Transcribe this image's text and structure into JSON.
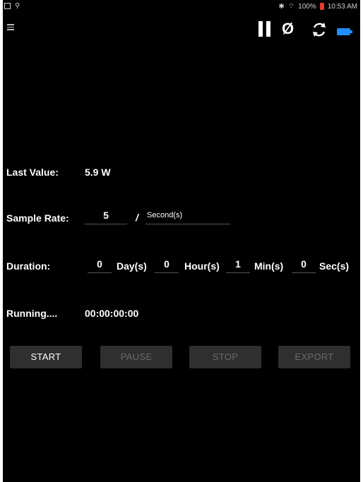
{
  "status_bar": {
    "battery_percent": "100%",
    "time": "10:53 AM",
    "icons": [
      "notification-icon",
      "usb-icon",
      "bluetooth-icon",
      "wifi-icon",
      "battery-low-icon"
    ]
  },
  "toolbar": {
    "icons": [
      "menu-icon",
      "pause-icon",
      "null-icon",
      "refresh-icon",
      "battery-icon"
    ],
    "null_symbol": "Ø",
    "battery_color": "#1e90ff"
  },
  "last_value": {
    "label": "Last Value:",
    "value": "5.9 W"
  },
  "sample_rate": {
    "label": "Sample Rate:",
    "value": "5",
    "separator": "/",
    "unit": "Second(s)"
  },
  "duration": {
    "label": "Duration:",
    "days": {
      "value": "0",
      "unit": "Day(s)"
    },
    "hours": {
      "value": "0",
      "unit": "Hour(s)"
    },
    "mins": {
      "value": "1",
      "unit": "Min(s)"
    },
    "secs": {
      "value": "0",
      "unit": "Sec(s)"
    }
  },
  "running": {
    "label": "Running....",
    "elapsed": "00:00:00:00"
  },
  "buttons": {
    "start": "START",
    "pause": "PAUSE",
    "stop": "STOP",
    "export": "EXPORT"
  },
  "colors": {
    "background": "#000000",
    "button_bg": "#2f2f2f",
    "disabled_text": "#6b6b6b",
    "accent": "#1e90ff"
  }
}
